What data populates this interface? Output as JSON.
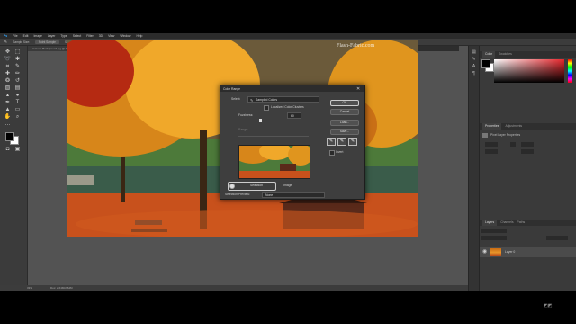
{
  "menubar": {
    "items": [
      "Ps",
      "File",
      "Edit",
      "Image",
      "Layer",
      "Type",
      "Select",
      "Filter",
      "3D",
      "View",
      "Window",
      "Help"
    ]
  },
  "options": {
    "tool": "Eyedropper",
    "sample_size_label": "Sample Size:",
    "sample_size_value": "Point Sample",
    "sample_label": "Sample:",
    "sample_value": "All Layers"
  },
  "tabs": [
    "Autumn Background.jpg @ 33.3% (Layer 0, RGB/8#)",
    "1fd.jpg @ 100% (Layer 0, RGB/8#)"
  ],
  "status": {
    "zoom": "33%",
    "doc": "Doc: 2.64M/2.64M"
  },
  "canvas": {
    "watermark": "Flash-Fabric.com"
  },
  "dialog": {
    "title": "Color Range",
    "select_label": "Select:",
    "select_value": "Sampled Colors",
    "localized_label": "Localized Color Clusters",
    "fuzziness_label": "Fuzziness:",
    "fuzziness_value": "60",
    "fuzziness_fraction": 0.3,
    "range_label": "Range:",
    "ok": "OK",
    "cancel": "Cancel",
    "load": "Load...",
    "save": "Save...",
    "invert": "Invert",
    "selection_radio": "Selection",
    "image_radio": "Image",
    "preview_label": "Selection Preview:",
    "preview_value": "None"
  },
  "panels": {
    "color_tabs": [
      "Color",
      "Swatches"
    ],
    "props_tabs": [
      "Properties",
      "Adjustments"
    ],
    "props_label": "Pixel Layer Properties",
    "layers_tabs": [
      "Layers",
      "Channels",
      "Paths"
    ],
    "layer_name": "Layer 0"
  },
  "colors": {
    "accent": "#e8262c",
    "fg": "#000000",
    "bg": "#ffffff"
  }
}
